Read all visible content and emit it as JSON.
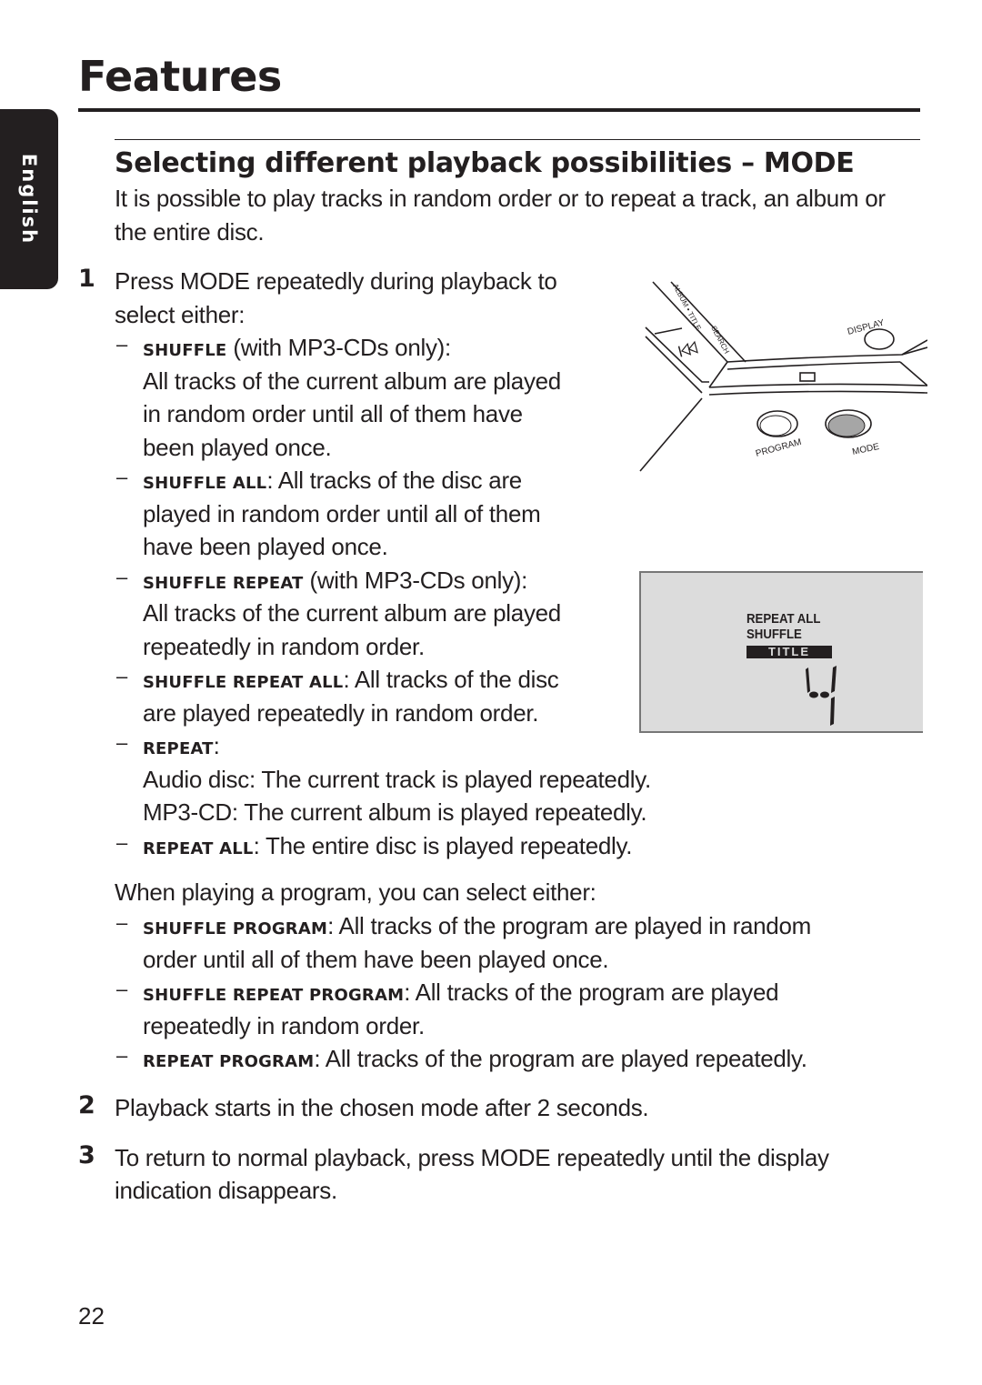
{
  "page": {
    "title": "Features",
    "language_tab": "English",
    "page_number": "22"
  },
  "section": {
    "title": "Selecting different playback possibilities – MODE",
    "intro_line1": "It is possible to play tracks in random order or to repeat a track, an album or",
    "intro_line2": "the entire disc."
  },
  "steps": [
    {
      "number": "1",
      "lines": [
        "Press MODE repeatedly during playback to",
        "select either:"
      ]
    },
    {
      "number": "2",
      "lines": [
        "Playback starts in the chosen mode after 2 seconds."
      ]
    },
    {
      "number": "3",
      "lines": [
        "To return to normal playback, press MODE repeatedly until the display",
        "indication disappears."
      ]
    }
  ],
  "modes": [
    {
      "dash": "–",
      "label": "SHUFFLE",
      "sep": " ",
      "first": "(with MP3-CDs only):",
      "lines": [
        "All tracks of the current album are played",
        "in random order until all of them have",
        "been played once."
      ]
    },
    {
      "dash": "–",
      "label": "SHUFFLE ALL",
      "sep": ": ",
      "first": "All tracks of the disc are",
      "lines": [
        "played in random order until all of them",
        "have been played once."
      ]
    },
    {
      "dash": "–",
      "label": "SHUFFLE REPEAT",
      "sep": " ",
      "first": "(with MP3-CDs only):",
      "lines": [
        "All tracks of the current album are played",
        "repeatedly in random order."
      ]
    },
    {
      "dash": "–",
      "label": "SHUFFLE REPEAT ALL",
      "sep": ": ",
      "first": "All tracks of the disc",
      "lines": [
        "are played repeatedly in random order."
      ]
    },
    {
      "dash": "–",
      "label": "REPEAT",
      "sep": ":",
      "first": "",
      "lines": [
        "Audio disc: The current track is played repeatedly.",
        "MP3-CD: The current album is played repeatedly."
      ]
    },
    {
      "dash": "–",
      "label": "REPEAT ALL",
      "sep": ": ",
      "first": "The entire disc is played repeatedly.",
      "lines": []
    }
  ],
  "program": {
    "intro": "When playing a program, you can select either:",
    "modes": [
      {
        "dash": "–",
        "label": "SHUFFLE PROGRAM",
        "sep": ": ",
        "first": "All tracks of the program are played in random",
        "lines": [
          "order until all of them have been played once."
        ]
      },
      {
        "dash": "–",
        "label": "SHUFFLE REPEAT PROGRAM",
        "sep": ": ",
        "first": "All tracks of the program are played",
        "lines": [
          "repeatedly in random order."
        ]
      },
      {
        "dash": "–",
        "label": "REPEAT PROGRAM",
        "sep": ": ",
        "first": "All tracks of the program are played repeatedly.",
        "lines": []
      }
    ]
  },
  "device_illustration": {
    "labels": {
      "title_label": "ALBUM • TITLE",
      "search_label": "SEARCH",
      "display": "DISPLAY",
      "program": "PROGRAM",
      "mode": "MODE"
    },
    "highlighted_button": "MODE"
  },
  "lcd_display": {
    "line1": "REPEAT ALL",
    "line2": "SHUFFLE",
    "title_badge": "TITLE",
    "digit": "4"
  }
}
